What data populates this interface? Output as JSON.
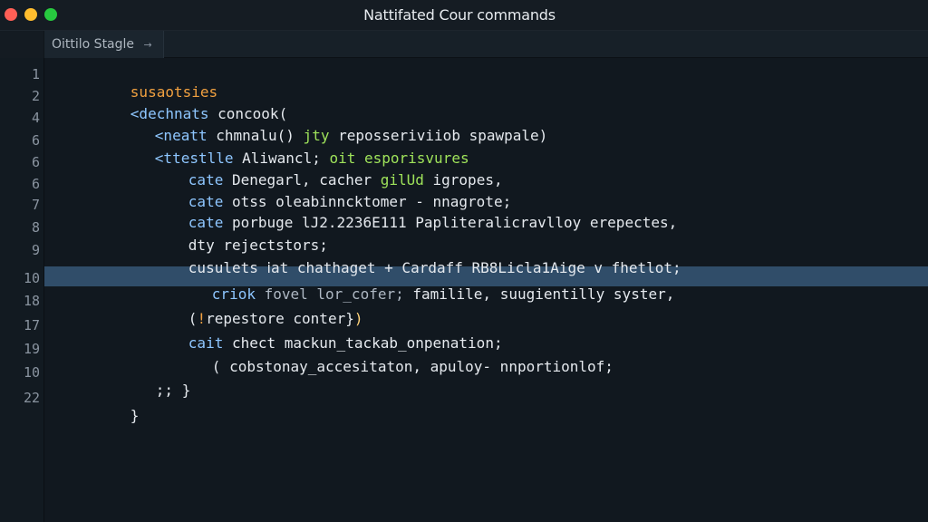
{
  "window": {
    "title": "Nattifated Cour commands"
  },
  "tabs": [
    {
      "label": "Oittilo Stagle",
      "arrow": "→"
    }
  ],
  "line_numbers": [
    "1",
    "2",
    "4",
    "6",
    "6",
    "6",
    "7",
    "8",
    "9",
    "10",
    "18",
    "17",
    "19",
    "10",
    "22"
  ],
  "lines": [
    {
      "parts": [
        "susaotsies"
      ]
    },
    {
      "parts": [
        "<dechnats",
        " concook("
      ]
    },
    {
      "parts": [
        "<neatt",
        " chmnalu()",
        " jty",
        " reposseriviiob spawpale)"
      ]
    },
    {
      "parts": [
        "<ttestlle",
        " Aliwancl;",
        " oit esporisvures"
      ]
    },
    {
      "parts": [
        "cate",
        " Denegarl,",
        " cacher",
        " gilUd",
        " igropes,"
      ]
    },
    {
      "parts": [
        "cate",
        " otss oleabinncktomer - nnagrote;"
      ]
    },
    {
      "parts": [
        "cate",
        " porbuge lJ2.2236E111 Papliteralicravlloy erepectes,"
      ]
    },
    {
      "parts": [
        "dty rejectstors;"
      ]
    },
    {
      "parts": [
        "cusulets",
        " ⅰat chathaget + Cardaff RB8Licla1Aige v fhetlot;"
      ]
    },
    {
      "parts": [
        "criok",
        " fovel",
        " lor_cofer;",
        " familile,",
        " suugientilly syster,"
      ]
    },
    {
      "parts": [
        "(",
        "!",
        "repestore conter}",
        ")"
      ]
    },
    {
      "parts": [
        "cait",
        " chect mackun_tackab_onpenation;"
      ]
    },
    {
      "parts": [
        "( cobstonay_accesitaton, apuloy- nnportionlof;"
      ]
    },
    {
      "parts": [
        ";;",
        " }"
      ]
    },
    {
      "parts": [
        "}"
      ]
    }
  ],
  "theme": {
    "editor_bg": "#11181f",
    "highlight_bg": "#304d69",
    "orange": "#f0a040",
    "blue": "#8ec6ff",
    "green": "#9fe35a"
  }
}
